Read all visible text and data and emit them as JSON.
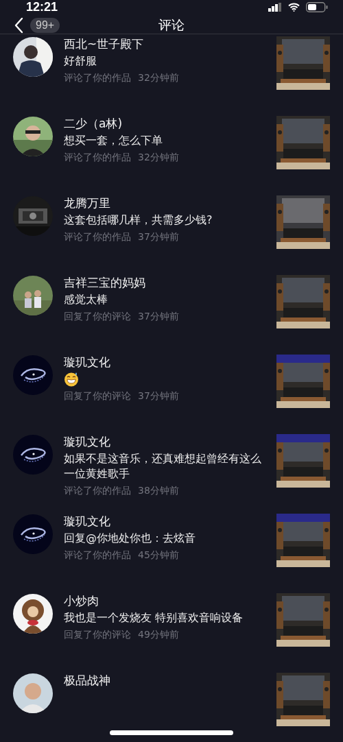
{
  "status_bar": {
    "time": "12:21"
  },
  "header": {
    "badge": "99+",
    "title": "评论"
  },
  "notifications": [
    {
      "name": "西北~世子殿下",
      "kind": "text",
      "comment": "好舒服",
      "action": "评论了你的作品",
      "time": "32分钟前"
    },
    {
      "name": "二少（a林)",
      "kind": "text",
      "comment": "想买一套，怎么下单",
      "action": "评论了你的作品",
      "time": "32分钟前"
    },
    {
      "name": "龙腾万里",
      "kind": "text",
      "comment": "这套包括哪几样，共需多少钱?",
      "action": "评论了你的作品",
      "time": "37分钟前"
    },
    {
      "name": "吉祥三宝的妈妈",
      "kind": "text",
      "comment": "感觉太棒",
      "action": "回复了你的评论",
      "time": "37分钟前"
    },
    {
      "name": "璇玑文化",
      "kind": "emoji",
      "action": "回复了你的评论",
      "time": "37分钟前"
    },
    {
      "name": "璇玑文化",
      "kind": "text",
      "comment": "如果不是这音乐，还真难想起曾经有这么一位黄姓歌手",
      "action": "评论了你的作品",
      "time": "38分钟前"
    },
    {
      "name": "璇玑文化",
      "kind": "text",
      "comment": "回复@你地处你也：去炫音",
      "action": "评论了你的作品",
      "time": "45分钟前"
    },
    {
      "name": "小炒肉",
      "kind": "text",
      "comment": "我也是一个发烧友 特别喜欢音响设备",
      "action": "回复了你的评论",
      "time": "49分钟前"
    },
    {
      "name": "极品战神",
      "kind": "text"
    }
  ]
}
